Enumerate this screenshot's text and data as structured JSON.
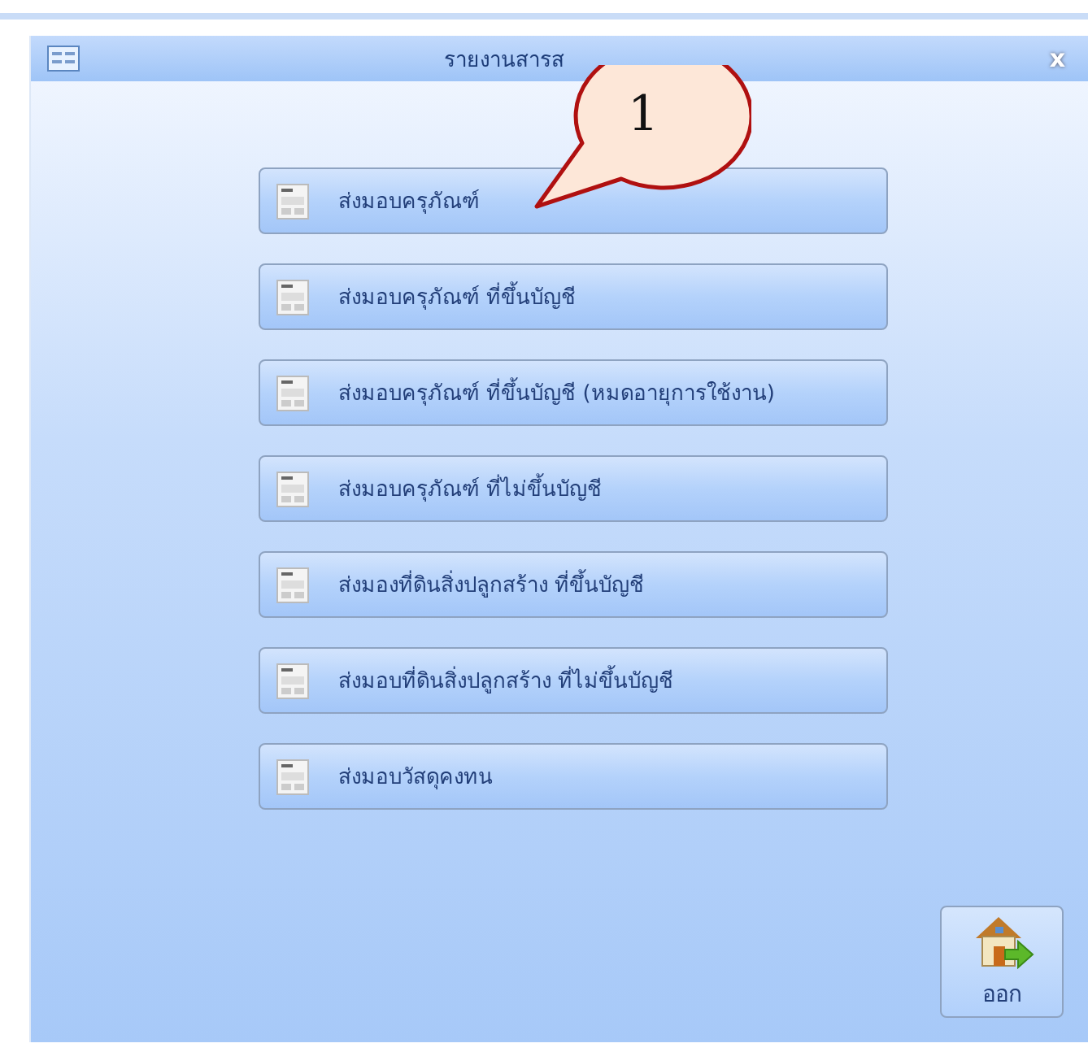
{
  "window": {
    "title": "รายงานสารส",
    "close": "x"
  },
  "callout": {
    "label": "1"
  },
  "menu_buttons": [
    {
      "label": "ส่งมอบครุภัณฑ์"
    },
    {
      "label": "ส่งมอบครุภัณฑ์ ที่ขึ้นบัญชี"
    },
    {
      "label": "ส่งมอบครุภัณฑ์ ที่ขึ้นบัญชี (หมดอายุการใช้งาน)"
    },
    {
      "label": "ส่งมอบครุภัณฑ์ ที่ไม่ขึ้นบัญชี"
    },
    {
      "label": "ส่งมองที่ดินสิ่งปลูกสร้าง ที่ขึ้นบัญชี"
    },
    {
      "label": "ส่งมอบที่ดินสิ่งปลูกสร้าง ที่ไม่ขึ้นบัญชี"
    },
    {
      "label": "ส่งมอบวัสดุคงทน"
    }
  ],
  "exit_button": {
    "label": "ออก"
  }
}
